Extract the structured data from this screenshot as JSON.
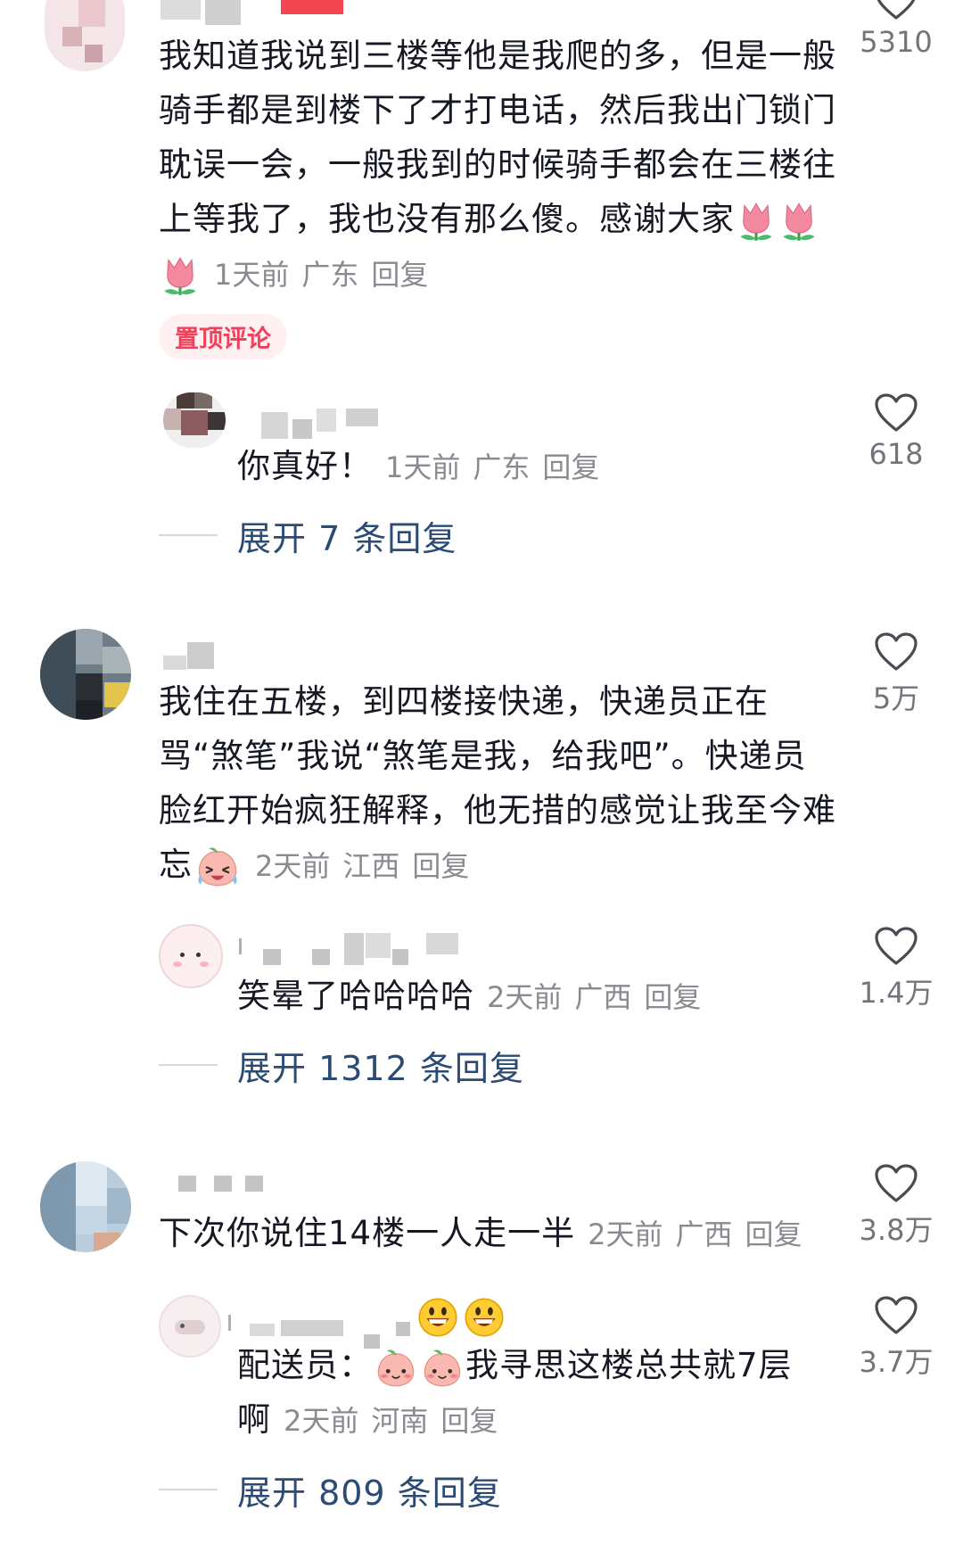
{
  "comments": [
    {
      "text": "我知道我说到三楼等他是我爬的多，但是一般骑手都是到楼下了才打电话，然后我出门锁门耽误一会，一般我到的时候骑手都会在三楼往上等我了，我也没有那么傻。感谢大家",
      "emoji": [
        "tulip-emoji",
        "tulip-emoji",
        "tulip-emoji"
      ],
      "time": "1天前",
      "location": "广东",
      "reply": "回复",
      "likes": "5310",
      "badge": "置顶评论",
      "replies": [
        {
          "text": "你真好！",
          "time": "1天前",
          "location": "广东",
          "reply": "回复",
          "likes": "618"
        }
      ],
      "expand_label": "展开 7 条回复"
    },
    {
      "text": "我住在五楼，到四楼接快递，快递员正在骂“煞笔”我说“煞笔是我，给我吧”。快递员脸红开始疯狂解释，他无措的感觉让我至今难忘",
      "emoji": [
        "crying-laugh-emoji"
      ],
      "time": "2天前",
      "location": "江西",
      "reply": "回复",
      "likes": "5万",
      "replies": [
        {
          "text": "笑晕了哈哈哈哈",
          "time": "2天前",
          "location": "广西",
          "reply": "回复",
          "likes": "1.4万"
        }
      ],
      "expand_label": "展开 1312 条回复"
    },
    {
      "text": "下次你说住14楼一人走一半",
      "time": "2天前",
      "location": "广西",
      "reply": "回复",
      "likes": "3.8万",
      "replies": [
        {
          "prefix": "配送员：",
          "text": "我寻思这楼总共就7层啊",
          "name_emoji": [
            "grin-emoji",
            "grin-emoji"
          ],
          "emoji": [
            "peach-face-emoji",
            "peach-face-emoji"
          ],
          "time": "2天前",
          "location": "河南",
          "reply": "回复",
          "likes": "3.7万"
        }
      ],
      "expand_label": "展开 809 条回复"
    }
  ],
  "colors": {
    "text": "#161823",
    "meta": "#8a8b91",
    "expand": "#2b4b74",
    "badge_bg": "#fff0f2",
    "badge_text": "#f0405a"
  }
}
